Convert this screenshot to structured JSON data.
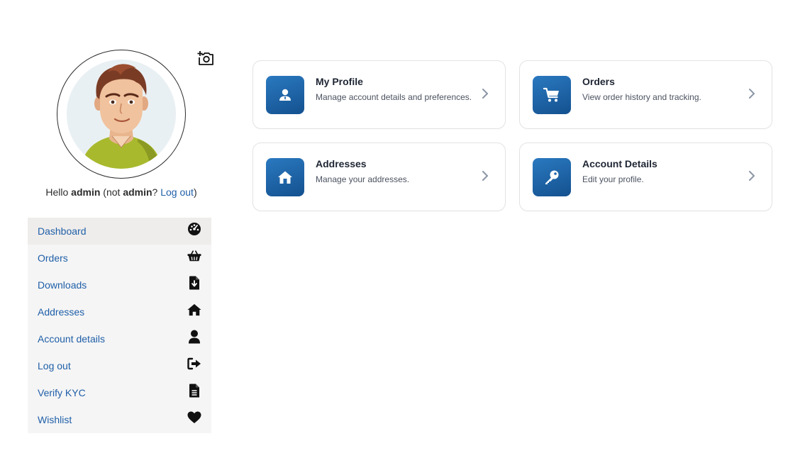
{
  "greeting": {
    "hello": "Hello",
    "username": "admin",
    "not_prefix": "(not",
    "not_username": "admin",
    "question": "?",
    "logout_link": "Log out",
    "close_paren": ")"
  },
  "avatar": {
    "icon": "user-avatar",
    "upload_icon": "camera-plus-icon"
  },
  "sidebar": {
    "items": [
      {
        "label": "Dashboard",
        "icon": "gauge-icon",
        "active": true
      },
      {
        "label": "Orders",
        "icon": "basket-icon",
        "active": false
      },
      {
        "label": "Downloads",
        "icon": "file-download-icon",
        "active": false
      },
      {
        "label": "Addresses",
        "icon": "home-icon",
        "active": false
      },
      {
        "label": "Account details",
        "icon": "user-icon",
        "active": false
      },
      {
        "label": "Log out",
        "icon": "logout-icon",
        "active": false
      },
      {
        "label": "Verify KYC",
        "icon": "document-icon",
        "active": false
      },
      {
        "label": "Wishlist",
        "icon": "heart-icon",
        "active": false
      }
    ]
  },
  "cards": [
    {
      "title": "My Profile",
      "description": "Manage account details and preferences.",
      "icon": "user-icon"
    },
    {
      "title": "Orders",
      "description": "View order history and tracking.",
      "icon": "cart-icon"
    },
    {
      "title": "Addresses",
      "description": "Manage your addresses.",
      "icon": "home-icon"
    },
    {
      "title": "Account Details",
      "description": "Edit your profile.",
      "icon": "key-icon"
    }
  ],
  "colors": {
    "link": "#1f5fa8",
    "card_icon_bg_top": "#2a79c0",
    "card_icon_bg_bottom": "#14518f",
    "sidebar_bg": "#f5f5f5",
    "sidebar_active_bg": "#efedeb"
  }
}
